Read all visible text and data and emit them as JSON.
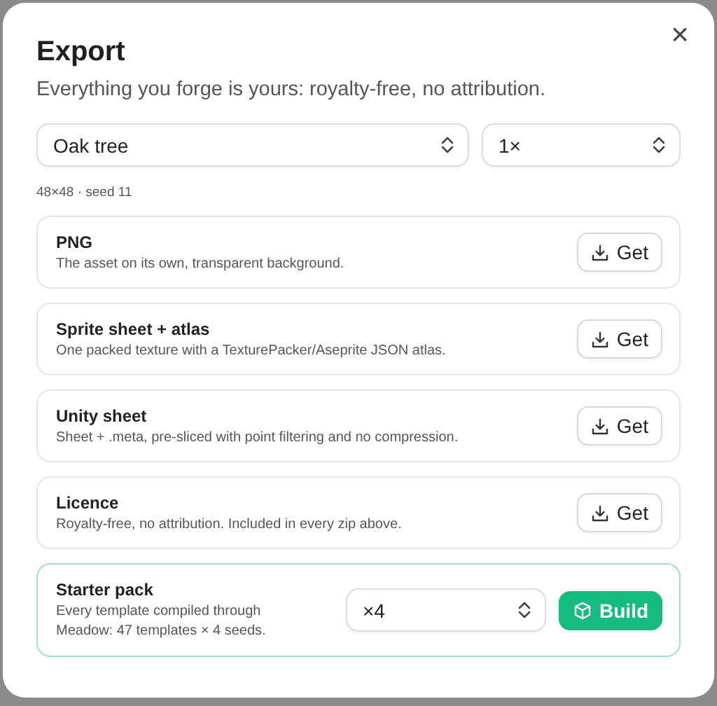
{
  "dialog": {
    "title": "Export",
    "subtitle": "Everything you forge is yours: royalty-free, no attribution.",
    "close": "×"
  },
  "selects": [
    {
      "value": "Oak tree"
    },
    {
      "value": "1×"
    }
  ],
  "meta": "48×48 · seed 11",
  "items": [
    {
      "kind": "download",
      "title": "PNG",
      "description": "The asset on its own, transparent background.",
      "button": "Get"
    },
    {
      "kind": "download",
      "title": "Sprite sheet + atlas",
      "description": "One packed texture with a TexturePacker/Aseprite JSON atlas.",
      "button": "Get"
    },
    {
      "kind": "download",
      "title": "Unity sheet",
      "description": "Sheet + .meta, pre-sliced with point filtering and no compression.",
      "button": "Get"
    },
    {
      "kind": "download",
      "title": "Licence",
      "description": "Royalty-free, no attribution. Included in every zip above.",
      "button": "Get"
    },
    {
      "kind": "pack",
      "title": "Starter pack",
      "description": "Every template compiled through Meadow: 47 templates × 4 seeds.",
      "select": "×4",
      "button": "Build"
    }
  ]
}
